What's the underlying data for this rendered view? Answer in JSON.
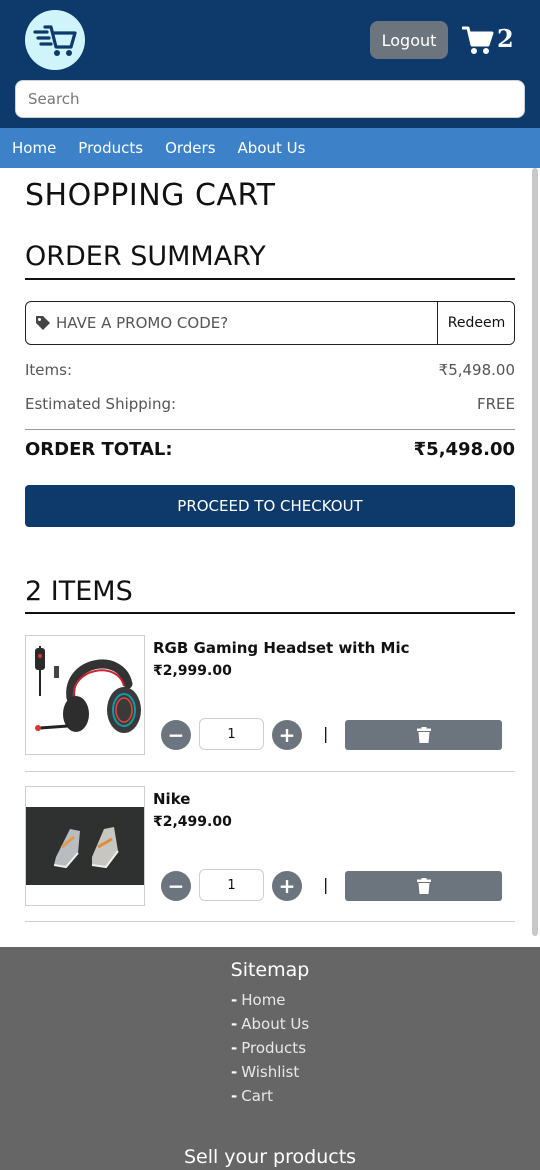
{
  "header": {
    "logout_label": "Logout",
    "cart_count": "2",
    "search_placeholder": "Search"
  },
  "nav": {
    "items": [
      "Home",
      "Products",
      "Orders",
      "About Us"
    ]
  },
  "page_title": "SHOPPING CART",
  "summary": {
    "title": "ORDER SUMMARY",
    "promo_placeholder": "HAVE A PROMO CODE?",
    "redeem_label": "Redeem",
    "items_label": "Items:",
    "items_value": "₹5,498.00",
    "shipping_label": "Estimated Shipping:",
    "shipping_value": "FREE",
    "total_label": "ORDER TOTAL:",
    "total_value": "₹5,498.00",
    "checkout_label": "PROCEED TO CHECKOUT"
  },
  "items_section": {
    "title": "2 ITEMS",
    "items": [
      {
        "name": "RGB Gaming Headset with Mic",
        "price": "₹2,999.00",
        "quantity": "1"
      },
      {
        "name": "Nike",
        "price": "₹2,499.00",
        "quantity": "1"
      }
    ],
    "separator": "|"
  },
  "footer": {
    "sitemap_title": "Sitemap",
    "links": [
      "Home",
      "About Us",
      "Products",
      "Wishlist",
      "Cart"
    ],
    "sell_title": "Sell your products"
  },
  "colors": {
    "header_bg": "#0d3a6b",
    "nav_bg": "#3d82c9",
    "button_gray": "#6c757d",
    "footer_bg": "#666666",
    "logo_bg": "#cff5fa"
  }
}
